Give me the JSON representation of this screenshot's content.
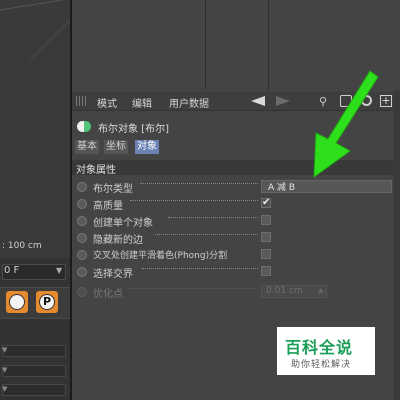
{
  "viewport": {
    "units_label": ": 100 cm"
  },
  "timeline": {
    "frame_value": "0 F",
    "frame_arrow": "▼",
    "play_label": "P",
    "field_arrows": [
      "▼",
      "▼",
      "▼"
    ]
  },
  "menubar": {
    "items": [
      "模式",
      "编辑",
      "用户数据"
    ]
  },
  "object": {
    "title": "布尔对象 [布尔]"
  },
  "tabs": [
    {
      "label": "基本",
      "active": false
    },
    {
      "label": "坐标",
      "active": false
    },
    {
      "label": "对象",
      "active": true
    }
  ],
  "section": {
    "label": "对象属性"
  },
  "properties": [
    {
      "label": "布尔类型",
      "type": "select",
      "value": "A 减 B"
    },
    {
      "label": "高质量",
      "type": "checkbox",
      "checked": true
    },
    {
      "label": "创建单个对象",
      "type": "checkbox",
      "checked": false
    },
    {
      "label": "隐藏新的边",
      "type": "checkbox",
      "checked": false
    },
    {
      "label": "交叉处创建平滑着色(Phong)分割",
      "type": "checkbox",
      "checked": false
    },
    {
      "label": "选择交界",
      "type": "checkbox",
      "checked": false
    },
    {
      "label": "优化点",
      "type": "number",
      "value": "0.01 cm",
      "disabled": true
    }
  ],
  "checkmark": "✔",
  "icons": {
    "search": "search-icon",
    "lock": "lock-icon",
    "target": "target-icon",
    "add": "add-icon",
    "nav_back": "arrow-left-icon",
    "nav_fwd": "arrow-right-icon",
    "object": "boolean-object-icon"
  },
  "colors": {
    "active_tab": "#6a83b4",
    "annotation_arrow": "#2ee01c",
    "tool_orange": "#e58a2e",
    "watermark_green": "#1a9e58"
  },
  "watermark": {
    "title": "百科全说",
    "subtitle": "助你轻松解决"
  }
}
